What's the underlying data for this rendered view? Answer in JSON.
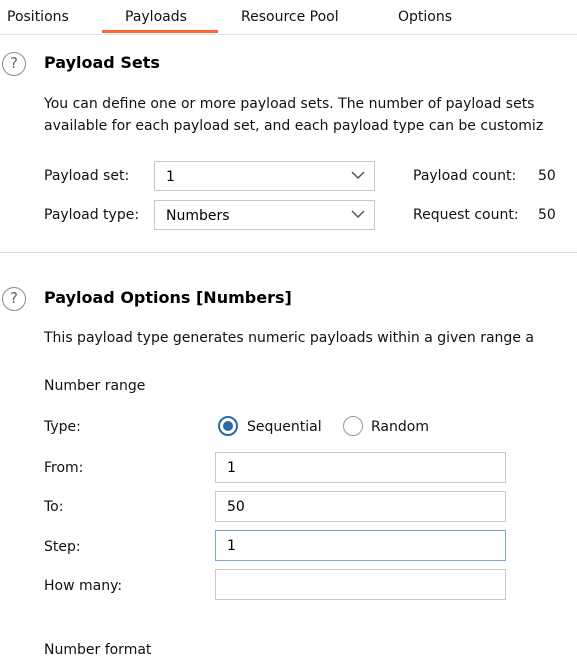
{
  "tabs": [
    {
      "label": "Positions"
    },
    {
      "label": "Payloads"
    },
    {
      "label": "Resource Pool"
    },
    {
      "label": "Options"
    }
  ],
  "payload_sets": {
    "title": "Payload Sets",
    "desc_line1": "You can define one or more payload sets. The number of payload sets",
    "desc_line2": "available for each payload set, and each payload type can be customiz",
    "payload_set_label": "Payload set:",
    "payload_set_value": "1",
    "payload_type_label": "Payload type:",
    "payload_type_value": "Numbers",
    "payload_count_label": "Payload count:",
    "payload_count_value": "50",
    "request_count_label": "Request count:",
    "request_count_value": "50"
  },
  "payload_options": {
    "title": "Payload Options [Numbers]",
    "desc": "This payload type generates numeric payloads within a given range a",
    "number_range_heading": "Number range",
    "type_label": "Type:",
    "radio_sequential": "Sequential",
    "radio_random": "Random",
    "selected_type": "Sequential",
    "from_label": "From:",
    "from_value": "1",
    "to_label": "To:",
    "to_value": "50",
    "step_label": "Step:",
    "step_value": "1",
    "how_many_label": "How many:",
    "how_many_value": "",
    "number_format_heading": "Number format"
  },
  "colors": {
    "active_tab_underline": "#ff6633",
    "radio_accent": "#2a6aa8",
    "focus_border": "#7aa7d9"
  },
  "help_icon_glyph": "?"
}
